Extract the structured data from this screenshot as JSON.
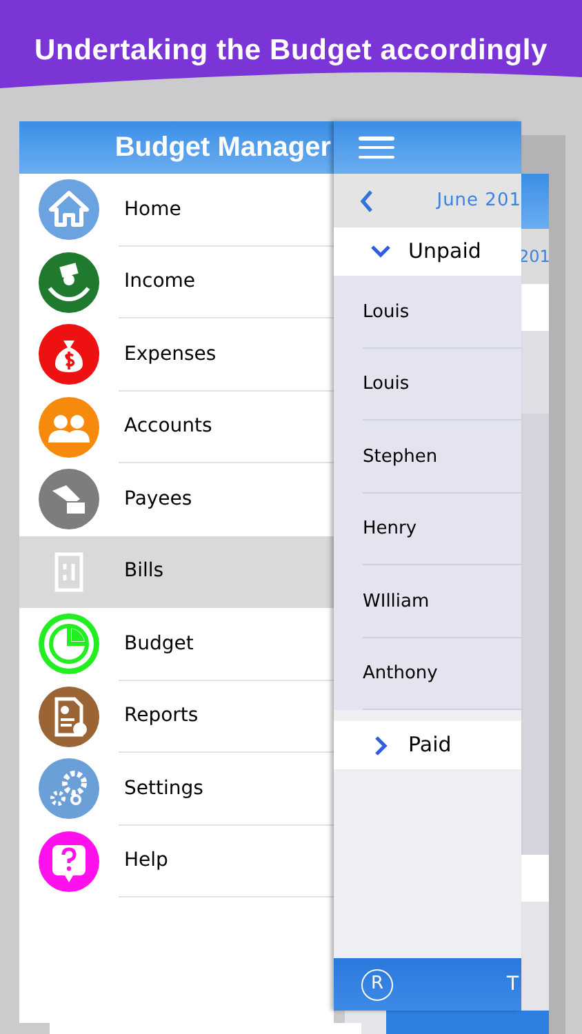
{
  "banner": {
    "title": "Undertaking the Budget accordingly"
  },
  "menu": {
    "title": "Budget Manager",
    "items": [
      {
        "label": "Home",
        "color": "#6aa3df",
        "selected": false
      },
      {
        "label": "Income",
        "color": "#1f7a2e",
        "selected": false
      },
      {
        "label": "Expenses",
        "color": "#ee1111",
        "selected": false
      },
      {
        "label": "Accounts",
        "color": "#f58a0c",
        "selected": false
      },
      {
        "label": "Payees",
        "color": "#7d7d7d",
        "selected": false
      },
      {
        "label": "Bills",
        "color": "#d9d9d9",
        "selected": true
      },
      {
        "label": "Budget",
        "color": "#22ee22",
        "selected": false
      },
      {
        "label": "Reports",
        "color": "#9a6434",
        "selected": false
      },
      {
        "label": "Settings",
        "color": "#6a9fd8",
        "selected": false
      },
      {
        "label": "Help",
        "color": "#ff11ee",
        "selected": false
      }
    ]
  },
  "bills_screen": {
    "month": "June 201",
    "sections": [
      {
        "label": "Unpaid",
        "expanded": true,
        "rows": [
          "Louis",
          "Louis",
          "Stephen",
          "Henry",
          "WIlliam",
          "Anthony"
        ]
      },
      {
        "label": "Paid",
        "expanded": false
      }
    ],
    "footer_button": "R",
    "footer_text": "T"
  },
  "back_screen": {
    "month": "201"
  }
}
